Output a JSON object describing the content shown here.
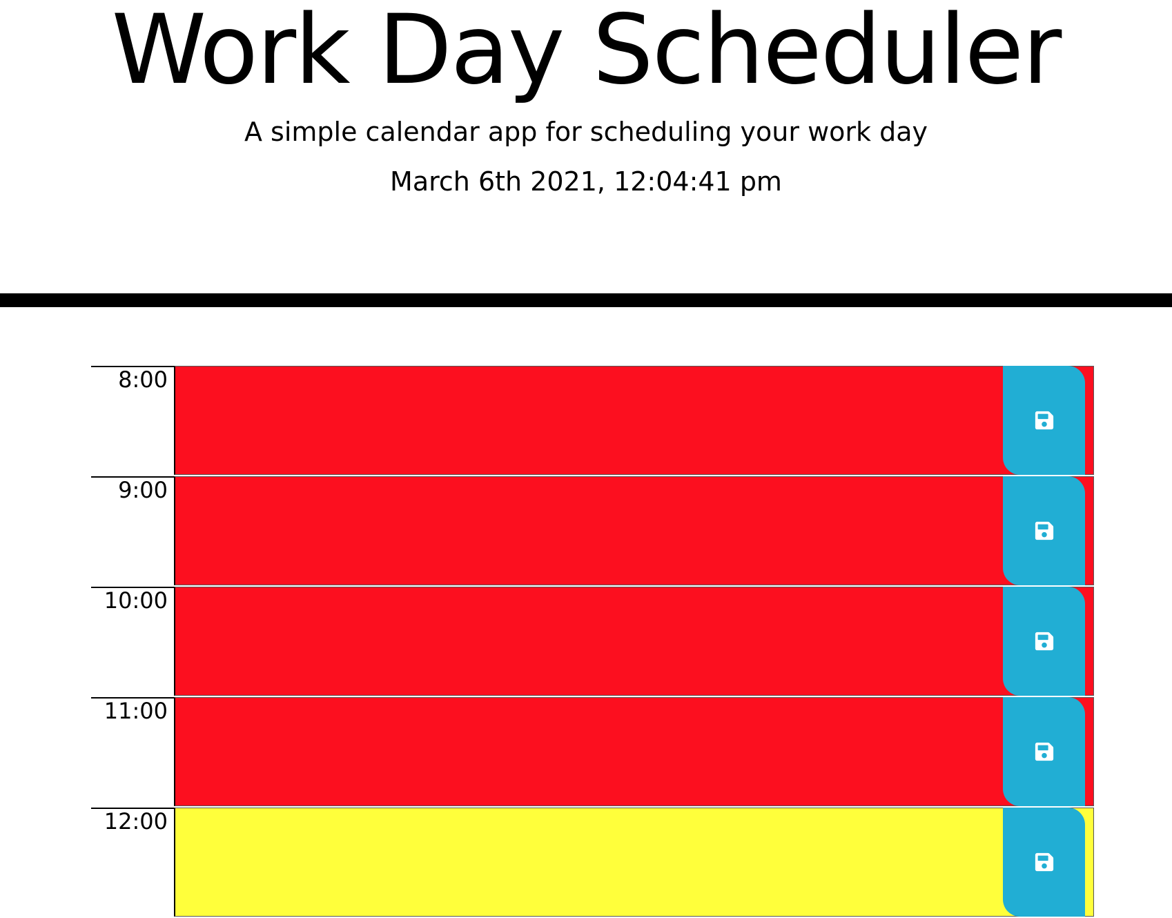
{
  "header": {
    "title": "Work Day Scheduler",
    "subtitle": "A simple calendar app for scheduling your work day",
    "current_datetime": "March 6th 2021, 12:04:41 pm"
  },
  "colors": {
    "past": "#fc0f1f",
    "present": "#ffff3b",
    "save_button": "#21aed4",
    "save_icon": "#ffffff",
    "divider": "#000000"
  },
  "time_blocks": [
    {
      "hour": "8:00",
      "state": "past",
      "text": "",
      "save_icon": "floppy-disk-icon"
    },
    {
      "hour": "9:00",
      "state": "past",
      "text": "",
      "save_icon": "floppy-disk-icon"
    },
    {
      "hour": "10:00",
      "state": "past",
      "text": "",
      "save_icon": "floppy-disk-icon"
    },
    {
      "hour": "11:00",
      "state": "past",
      "text": "",
      "save_icon": "floppy-disk-icon"
    },
    {
      "hour": "12:00",
      "state": "present",
      "text": "",
      "save_icon": "floppy-disk-icon"
    }
  ]
}
